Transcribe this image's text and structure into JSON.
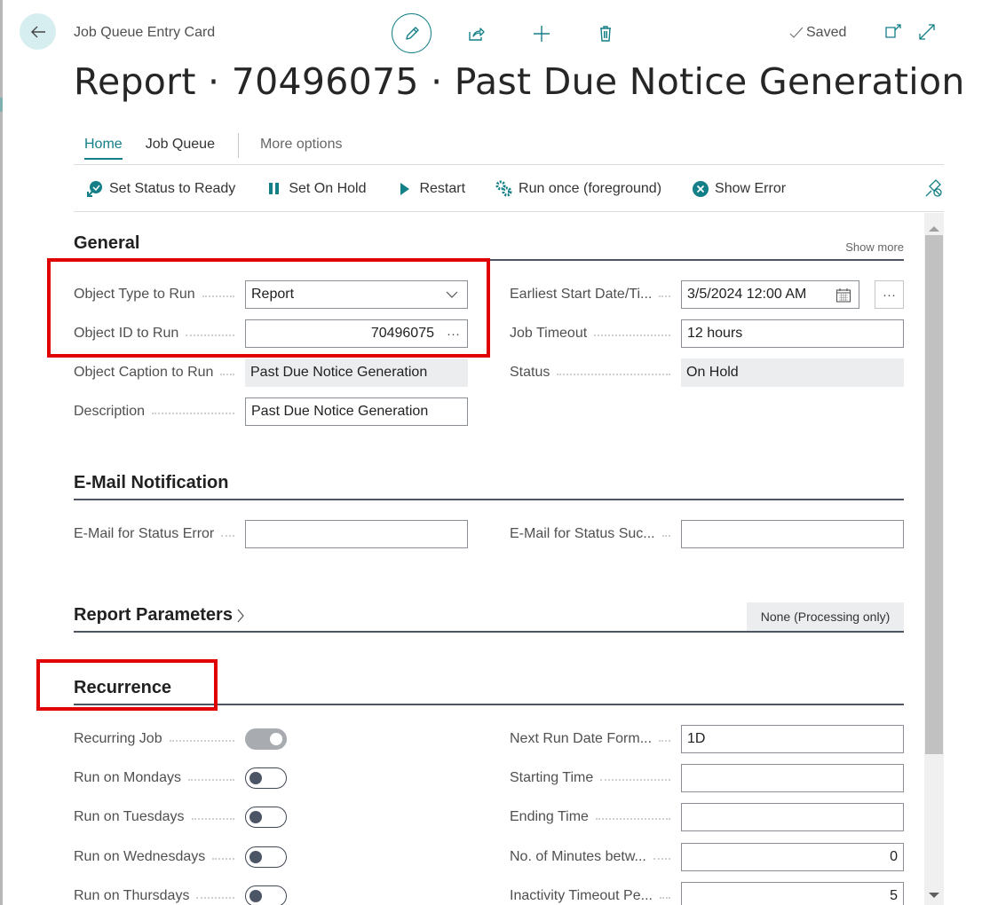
{
  "header": {
    "card_type": "Job Queue Entry Card",
    "title": "Report · 70496075 · Past Due Notice Generation",
    "saved_label": "Saved",
    "icons": [
      "back-arrow-icon",
      "edit-pencil-icon",
      "share-icon",
      "plus-icon",
      "trash-icon",
      "checkmark-icon",
      "open-new-window-icon",
      "expand-icon"
    ]
  },
  "tabs": [
    {
      "label": "Home",
      "active": true
    },
    {
      "label": "Job Queue",
      "active": false
    },
    {
      "label": "More options",
      "active": false
    }
  ],
  "actions": [
    {
      "label": "Set Status to Ready",
      "icon": "status-ready-icon"
    },
    {
      "label": "Set On Hold",
      "icon": "pause-icon"
    },
    {
      "label": "Restart",
      "icon": "play-icon"
    },
    {
      "label": "Run once (foreground)",
      "icon": "run-gears-icon"
    },
    {
      "label": "Show Error",
      "icon": "error-circle-icon"
    }
  ],
  "sections": {
    "general": {
      "title": "General",
      "show_more": "Show more",
      "left": [
        {
          "label": "Object Type to Run",
          "value": "Report",
          "type": "dropdown"
        },
        {
          "label": "Object ID to Run",
          "value": "70496075",
          "type": "lookup"
        },
        {
          "label": "Object Caption to Run",
          "value": "Past Due Notice Generation",
          "type": "readonly"
        },
        {
          "label": "Description",
          "value": "Past Due Notice Generation",
          "type": "text"
        }
      ],
      "right": [
        {
          "label": "Earliest Start Date/Ti...",
          "value": "3/5/2024 12:00 AM",
          "type": "datetime"
        },
        {
          "label": "Job Timeout",
          "value": "12 hours",
          "type": "text"
        },
        {
          "label": "Status",
          "value": "On Hold",
          "type": "readonly"
        }
      ]
    },
    "email": {
      "title": "E-Mail Notification",
      "left": [
        {
          "label": "E-Mail for Status Error",
          "value": ""
        }
      ],
      "right": [
        {
          "label": "E-Mail for Status Suc...",
          "value": ""
        }
      ]
    },
    "report_params": {
      "title": "Report Parameters",
      "value": "None (Processing only)"
    },
    "recurrence": {
      "title": "Recurrence",
      "left": [
        {
          "label": "Recurring Job",
          "on": true
        },
        {
          "label": "Run on Mondays",
          "on": false
        },
        {
          "label": "Run on Tuesdays",
          "on": false
        },
        {
          "label": "Run on Wednesdays",
          "on": false
        },
        {
          "label": "Run on Thursdays",
          "on": false
        }
      ],
      "right": [
        {
          "label": "Next Run Date Form...",
          "value": "1D"
        },
        {
          "label": "Starting Time",
          "value": ""
        },
        {
          "label": "Ending Time",
          "value": ""
        },
        {
          "label": "No. of Minutes betw...",
          "value": "0"
        },
        {
          "label": "Inactivity Timeout Pe...",
          "value": "5"
        }
      ]
    }
  },
  "colors": {
    "accent": "#137f86",
    "highlight": "#e00000",
    "readonly_bg": "#ebedef"
  }
}
